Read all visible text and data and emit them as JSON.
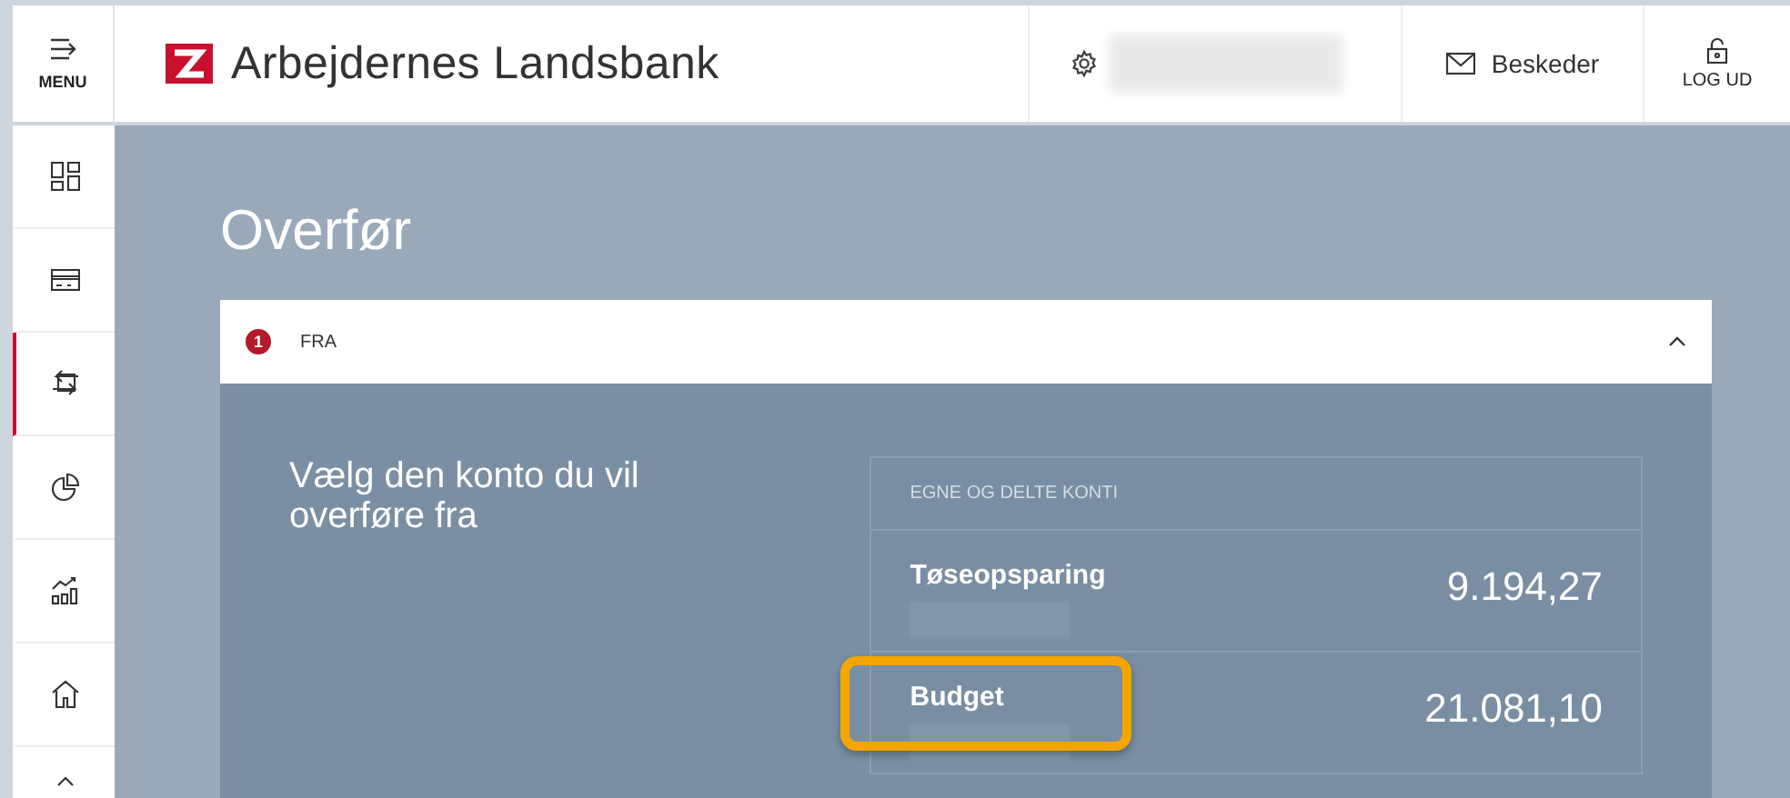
{
  "header": {
    "menu_label": "MENU",
    "bank_name": "Arbejdernes Landsbank",
    "messages_label": "Beskeder",
    "logout_label": "LOG UD"
  },
  "sidebar": {
    "items": [
      {
        "kind": "dashboard",
        "selected": false
      },
      {
        "kind": "card",
        "selected": false
      },
      {
        "kind": "transfer",
        "selected": true
      },
      {
        "kind": "pie",
        "selected": false
      },
      {
        "kind": "chart",
        "selected": false
      },
      {
        "kind": "home",
        "selected": false
      },
      {
        "kind": "more",
        "selected": false
      }
    ]
  },
  "page_title": "Overfør",
  "step": {
    "number": "1",
    "title": "FRA",
    "expanded": true
  },
  "prompt": "Vælg den konto du vil overføre fra",
  "accounts": {
    "heading": "EGNE OG DELTE KONTI",
    "items": [
      {
        "name": "Tøseopsparing",
        "balance": "9.194,27",
        "highlighted": false
      },
      {
        "name": "Budget",
        "balance": "21.081,10",
        "highlighted": true
      }
    ]
  }
}
